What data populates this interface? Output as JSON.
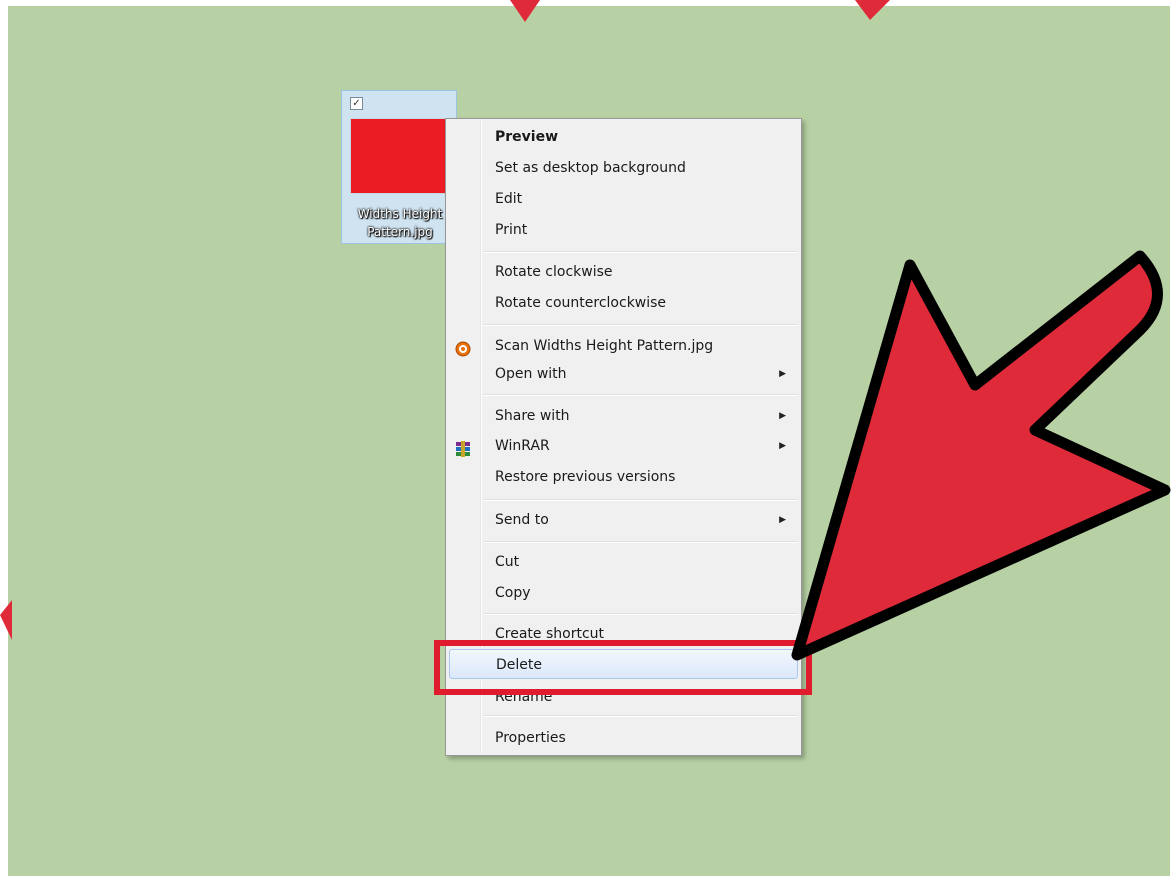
{
  "desktop": {
    "background": "#b7d1a4",
    "file": {
      "name_line1": "Widths Height",
      "name_line2": "Pattern.jpg",
      "checked_mark": "✓",
      "thumbnail_color": "#ec1c24"
    }
  },
  "context_menu": {
    "items": [
      {
        "label": "Preview",
        "bold": true
      },
      {
        "label": "Set as desktop background"
      },
      {
        "label": "Edit"
      },
      {
        "label": "Print"
      },
      {
        "label": "Rotate clockwise"
      },
      {
        "label": "Rotate counterclockwise"
      },
      {
        "label": "Scan Widths Height Pattern.jpg",
        "icon": "antivirus-scan-icon"
      },
      {
        "label": "Open with",
        "submenu": true
      },
      {
        "label": "Share with",
        "submenu": true
      },
      {
        "label": "WinRAR",
        "submenu": true,
        "icon": "winrar-icon"
      },
      {
        "label": "Restore previous versions"
      },
      {
        "label": "Send to",
        "submenu": true
      },
      {
        "label": "Cut"
      },
      {
        "label": "Copy"
      },
      {
        "label": "Create shortcut"
      },
      {
        "label": "Delete",
        "highlighted": true
      },
      {
        "label": "Rename"
      },
      {
        "label": "Properties"
      }
    ],
    "submenu_arrow": "▶"
  },
  "annotation": {
    "arrow_color": "#df2a3a",
    "outline_color": "#000000",
    "box_color": "#e01b2e"
  }
}
